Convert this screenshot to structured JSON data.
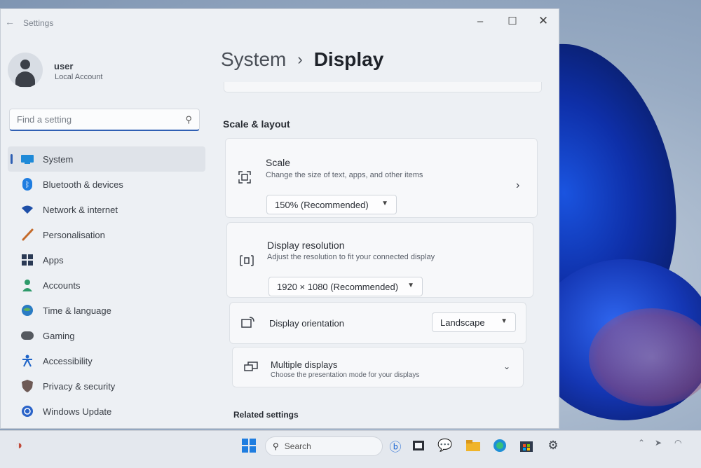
{
  "window": {
    "title": "Settings",
    "back_icon": "back-arrow-icon"
  },
  "controls": {
    "minimize": "–",
    "maximize": "☐",
    "close": "✕"
  },
  "account": {
    "name": "user",
    "type": "Local Account"
  },
  "search": {
    "placeholder": "Find a setting",
    "icon": "search-icon"
  },
  "nav": {
    "items": [
      {
        "label": "System",
        "icon": "system-icon",
        "active": true
      },
      {
        "label": "Bluetooth & devices",
        "icon": "bluetooth-icon"
      },
      {
        "label": "Network & internet",
        "icon": "wifi-icon"
      },
      {
        "label": "Personalisation",
        "icon": "brush-icon"
      },
      {
        "label": "Apps",
        "icon": "apps-icon"
      },
      {
        "label": "Accounts",
        "icon": "person-icon"
      },
      {
        "label": "Time & language",
        "icon": "globe-icon"
      },
      {
        "label": "Gaming",
        "icon": "gamepad-icon"
      },
      {
        "label": "Accessibility",
        "icon": "accessibility-icon"
      },
      {
        "label": "Privacy & security",
        "icon": "shield-icon"
      },
      {
        "label": "Windows Update",
        "icon": "update-icon"
      }
    ]
  },
  "breadcrumb": {
    "parent": "System",
    "separator": "›",
    "current": "Display"
  },
  "sections": {
    "scale_layout": "Scale & layout",
    "related": "Related settings"
  },
  "cards": {
    "scale": {
      "title": "Scale",
      "description": "Change the size of text, apps, and other items",
      "value": "150% (Recommended)"
    },
    "resolution": {
      "title": "Display resolution",
      "description": "Adjust the resolution to fit your connected display",
      "value": "1920 × 1080 (Recommended)"
    },
    "orientation": {
      "title": "Display orientation",
      "value": "Landscape"
    },
    "multiple": {
      "title": "Multiple displays",
      "description": "Choose the presentation mode for your displays"
    }
  },
  "taskbar": {
    "search_label": "Search"
  },
  "colors": {
    "accent": "#2f5fb3",
    "window_bg": "#edf0f4",
    "card_bg": "#f7f8fa"
  }
}
